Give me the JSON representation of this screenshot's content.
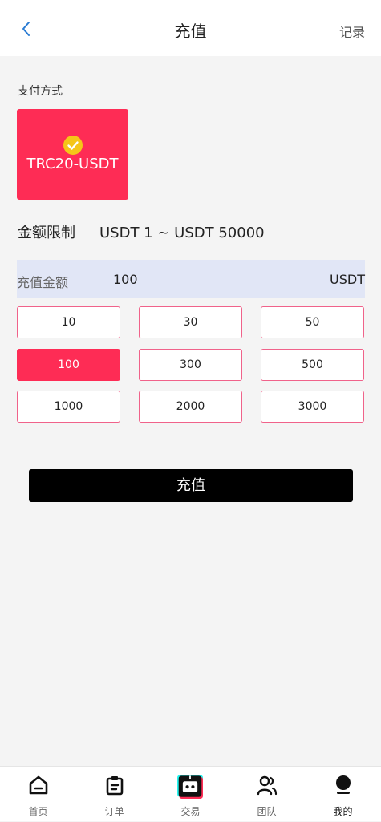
{
  "header": {
    "title": "充值",
    "record_label": "记录"
  },
  "payment": {
    "label": "支付方式",
    "method": "TRC20-USDT"
  },
  "limit": {
    "label": "金额限制",
    "value": "USDT 1 ~ USDT 50000"
  },
  "amount": {
    "label": "充值金额",
    "value": "100",
    "unit": "USDT"
  },
  "options": [
    "10",
    "30",
    "50",
    "100",
    "300",
    "500",
    "1000",
    "2000",
    "3000"
  ],
  "selected_option": "100",
  "submit_label": "充值",
  "tabbar": {
    "items": [
      {
        "label": "首页",
        "icon": "home-icon"
      },
      {
        "label": "订单",
        "icon": "clipboard-icon"
      },
      {
        "label": "交易",
        "icon": "robot-icon"
      },
      {
        "label": "团队",
        "icon": "team-icon"
      },
      {
        "label": "我的",
        "icon": "user-icon"
      }
    ],
    "active": "我的"
  },
  "colors": {
    "accent": "#fe2c55",
    "submit": "#000000",
    "amount_bar": "#e1e6f6",
    "check": "#f5c518"
  }
}
